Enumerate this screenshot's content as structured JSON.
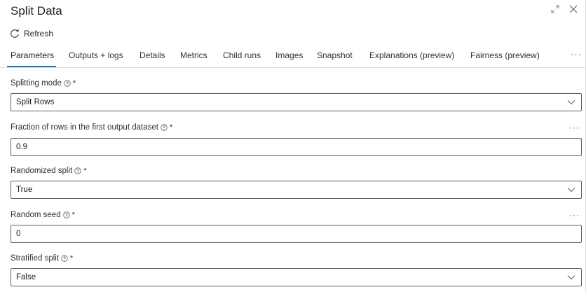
{
  "panel": {
    "title": "Split Data",
    "expand_icon": "expand-icon",
    "close_icon": "close-icon"
  },
  "toolbar": {
    "refresh_label": "Refresh",
    "refresh_icon": "refresh-icon"
  },
  "tabs": [
    {
      "label": "Parameters",
      "active": true
    },
    {
      "label": "Outputs + logs"
    },
    {
      "label": "Details"
    },
    {
      "label": "Metrics"
    },
    {
      "label": "Child runs"
    },
    {
      "label": "Images"
    },
    {
      "label": "Snapshot"
    },
    {
      "label": "Explanations (preview)"
    },
    {
      "label": "Fairness (preview)"
    }
  ],
  "tabs_more": "···",
  "fields": {
    "splitting_mode": {
      "label": "Splitting mode",
      "required": "*",
      "value": "Split Rows"
    },
    "fraction": {
      "label": "Fraction of rows in the first output dataset",
      "required": "*",
      "value": "0.9",
      "more": "···"
    },
    "randomized_split": {
      "label": "Randomized split",
      "required": "*",
      "value": "True"
    },
    "random_seed": {
      "label": "Random seed",
      "required": "*",
      "value": "0",
      "more": "···"
    },
    "stratified_split": {
      "label": "Stratified split",
      "required": "*",
      "value": "False"
    }
  },
  "colors": {
    "accent": "#0078d4",
    "border": "#605e5c",
    "divider": "#e1dfdd"
  }
}
